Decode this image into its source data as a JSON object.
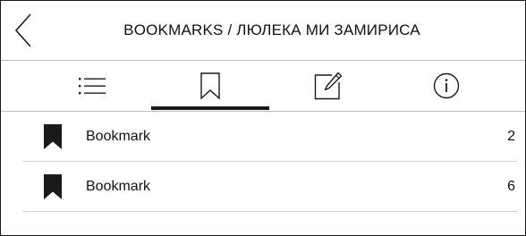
{
  "header": {
    "title": "BOOKMARKS / ЛЮЛЕКА МИ ЗАМИРИСА",
    "back_icon": "chevron-left-icon"
  },
  "tabs": [
    {
      "id": "contents",
      "icon": "list-icon",
      "selected": false
    },
    {
      "id": "bookmarks",
      "icon": "bookmark-outline-icon",
      "selected": true
    },
    {
      "id": "notes",
      "icon": "edit-note-icon",
      "selected": false
    },
    {
      "id": "info",
      "icon": "info-icon",
      "selected": false
    }
  ],
  "bookmarks": [
    {
      "label": "Bookmark",
      "page": "2",
      "icon": "bookmark-filled-icon"
    },
    {
      "label": "Bookmark",
      "page": "6",
      "icon": "bookmark-filled-icon"
    }
  ],
  "colors": {
    "ink": "#1a1a1a",
    "divider": "#bdbdbd",
    "background": "#ffffff"
  }
}
